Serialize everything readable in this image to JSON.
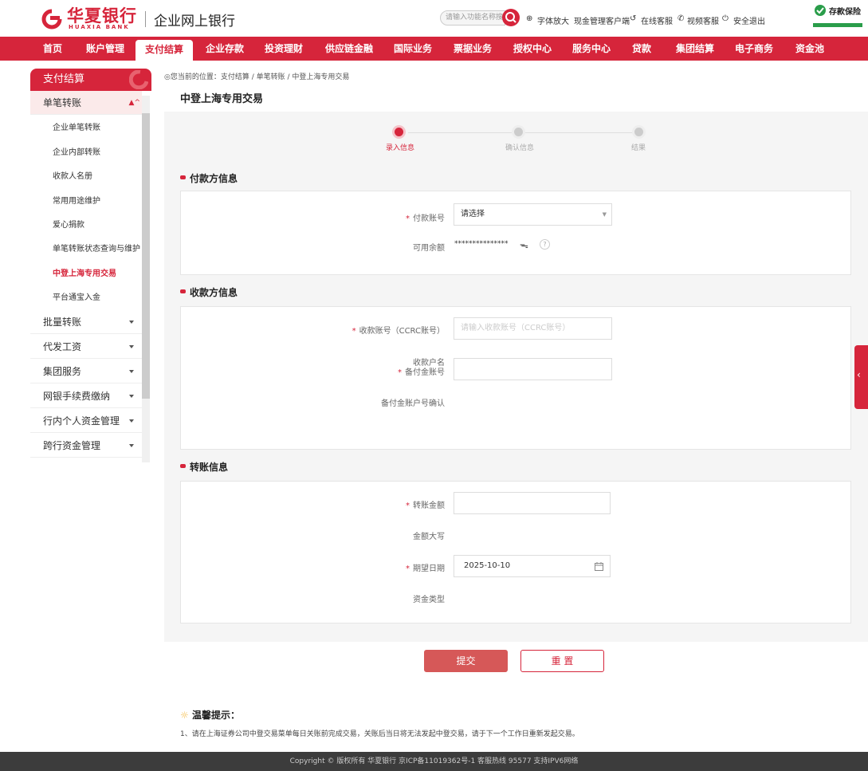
{
  "header": {
    "logo_cn": "华夏银行",
    "logo_en": "HUAXIA BANK",
    "subtitle": "企业网上银行",
    "search_placeholder": "请输入功能名称搜索",
    "links": [
      "字体放大",
      "现金管理客户端",
      "在线客服",
      "视频客服",
      "安全退出"
    ],
    "deposit_label": "存款保险"
  },
  "nav": [
    "首页",
    "账户管理",
    "支付结算",
    "企业存款",
    "投资理财",
    "供应链金融",
    "国际业务",
    "票据业务",
    "授权中心",
    "服务中心",
    "贷款",
    "集团结算",
    "电子商务",
    "资金池"
  ],
  "nav_active": "支付结算",
  "sidebar": {
    "title": "支付结算",
    "group_open": "单笔转账",
    "sub_items": [
      "企业单笔转账",
      "企业内部转账",
      "收款人名册",
      "常用用途维护",
      "爱心捐款",
      "单笔转账状态查询与维护",
      "中登上海专用交易",
      "平台通宝入金"
    ],
    "active_item": "中登上海专用交易",
    "groups": [
      "批量转账",
      "代发工资",
      "集团服务",
      "网银手续费缴纳",
      "行内个人资金管理",
      "跨行资金管理"
    ]
  },
  "breadcrumb": "您当前的位置：支付结算 / 单笔转账 / 中登上海专用交易",
  "page_title": "中登上海专用交易",
  "steps": [
    "录入信息",
    "确认信息",
    "结果"
  ],
  "sections": {
    "payer": {
      "title": "付款方信息",
      "account_label": "付款账号",
      "account_value": "请选择",
      "balance_label": "可用余额",
      "balance_value": "***************"
    },
    "payee": {
      "title": "收款方信息",
      "account_label": "收款账号（CCRC账号）",
      "account_placeholder": "请输入收款账号（CCRC账号）",
      "name_label": "收款户名",
      "reserve_label": "备付金账号",
      "reserve_confirm_label": "备付金账户号确认"
    },
    "transfer": {
      "title": "转账信息",
      "amount_label": "转账金额",
      "amount_upper_label": "金额大写",
      "date_label": "期望日期",
      "date_value": "2025-10-10",
      "fund_type_label": "资金类型"
    }
  },
  "buttons": {
    "submit": "提交",
    "reset": "重 置"
  },
  "tips": {
    "title": "温馨提示：",
    "text": "1、请在上海证券公司中登交易菜单每日关账前完成交易，关账后当日将无法发起中登交易，请于下一个工作日重新发起交易。"
  },
  "footer": "Copyright © 版权所有 华夏银行 京ICP备11019362号-1 客服热线 95577 支持IPV6网络",
  "colors": {
    "brand": "#d6253b",
    "submit": "#d65858"
  }
}
